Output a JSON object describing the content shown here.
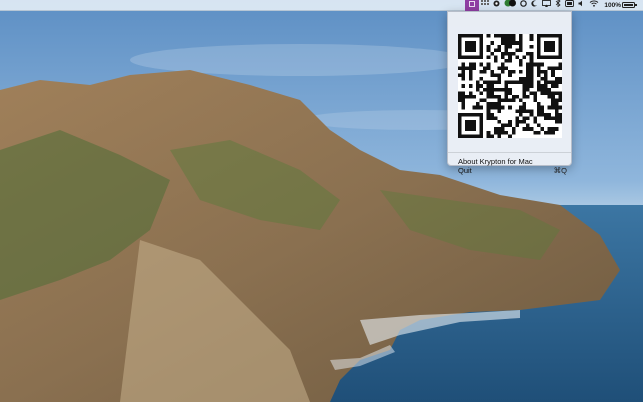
{
  "menubar": {
    "items": [
      {
        "icon": "krypton-qr-icon",
        "label": ""
      },
      {
        "icon": "grid-icon",
        "label": ""
      },
      {
        "icon": "circle-app-icon",
        "label": ""
      },
      {
        "icon": "badge-app-icon",
        "label": ""
      },
      {
        "icon": "sync-icon",
        "label": ""
      },
      {
        "icon": "moon-icon",
        "label": ""
      },
      {
        "icon": "airplay-icon",
        "label": ""
      },
      {
        "icon": "bluetooth-icon",
        "label": ""
      },
      {
        "icon": "display-icon",
        "label": ""
      },
      {
        "icon": "volume-icon",
        "label": ""
      },
      {
        "icon": "wifi-icon",
        "label": ""
      }
    ],
    "battery_percent_label": "100%",
    "battery_level": 1.0
  },
  "dropdown": {
    "about_label": "About Krypton for Mac",
    "quit_label": "Quit",
    "quit_shortcut": "⌘Q"
  },
  "colors": {
    "active_menu_item": "#8f3fa3",
    "sky_top": "#5d8fc4",
    "sea": "#2d5f8a"
  }
}
